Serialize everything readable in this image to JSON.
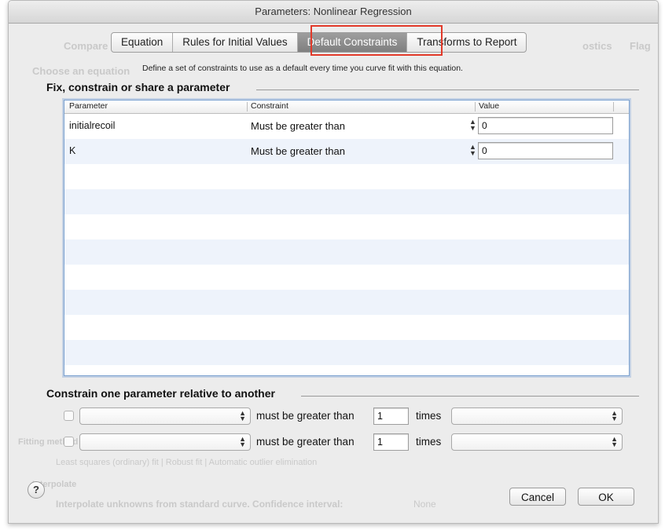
{
  "window": {
    "title": "Parameters: Nonlinear Regression"
  },
  "tabs": [
    {
      "label": "Equation"
    },
    {
      "label": "Rules for Initial Values"
    },
    {
      "label": "Default Constraints"
    },
    {
      "label": "Transforms to Report"
    }
  ],
  "active_tab": "Default Constraints",
  "highlight_color": "#e23a2a",
  "description": "Define a set of constraints to use as a default every time you curve fit with this equation.",
  "fix_section": {
    "title": "Fix, constrain or share a parameter",
    "columns": {
      "parameter": "Parameter",
      "constraint": "Constraint",
      "value": "Value"
    },
    "rows": [
      {
        "parameter": "initialrecoil",
        "constraint": "Must be greater than",
        "value": "0"
      },
      {
        "parameter": "K",
        "constraint": "Must be greater than",
        "value": "0"
      }
    ]
  },
  "relative_section": {
    "title": "Constrain one parameter relative to another",
    "rows": [
      {
        "relation": "must be greater than",
        "factor": "1",
        "times_label": "times"
      },
      {
        "relation": "must be greater than",
        "factor": "1",
        "times_label": "times"
      }
    ]
  },
  "background_ghost": {
    "choose_equation": "Choose an equation",
    "compare": "Compare",
    "fitting_method": "Fitting method",
    "fit_options": "Least squares (ordinary) fit  |  Robust fit  |  Automatic outlier elimination",
    "interpolate": "Interpolate",
    "interpolate_text": "Interpolate unknowns from standard curve. Confidence interval:",
    "none": "None",
    "flag": "Flag",
    "diagnostics": "ostics"
  },
  "buttons": {
    "help": "?",
    "cancel": "Cancel",
    "ok": "OK"
  }
}
